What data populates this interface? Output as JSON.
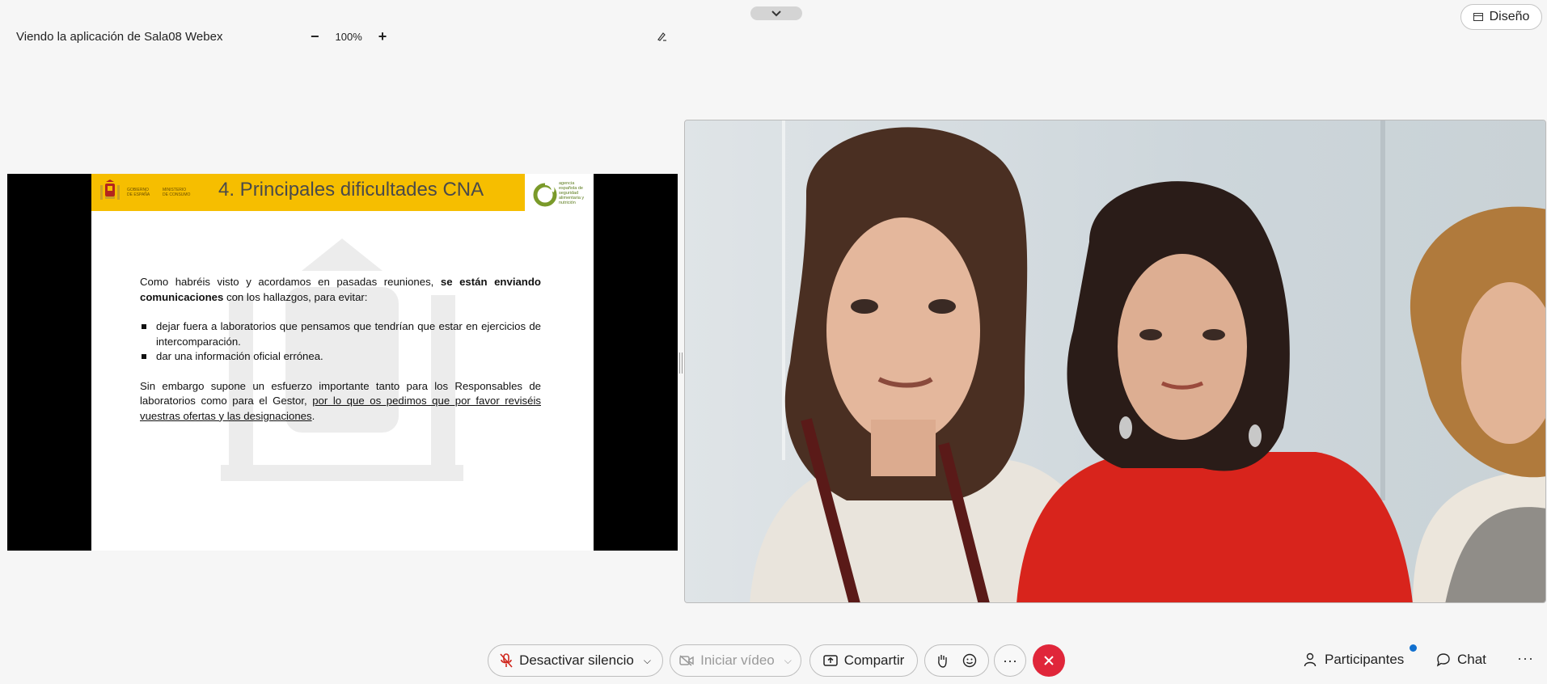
{
  "top": {
    "viewing_label": "Viendo la aplicación de Sala08 Webex",
    "zoom_minus": "−",
    "zoom_value": "100%",
    "zoom_plus": "+",
    "layout_label": "Diseño"
  },
  "slide": {
    "title": "4. Principales dificultades CNA",
    "gov_label": "GOBIERNO DE ESPAÑA",
    "ministry_label": "MINISTERIO DE CONSUMO",
    "logo_text": "agencia española de seguridad alimentaria y nutrición",
    "para1_a": "Como habréis visto y acordamos en pasadas reuniones, ",
    "para1_bold": "se están enviando comunicaciones",
    "para1_b": " con los hallazgos, para evitar:",
    "bullets": [
      "dejar fuera a laboratorios que pensamos que tendrían que estar en ejercicios de intercomparación.",
      "dar una información oficial errónea."
    ],
    "para2_a": "Sin embargo supone un esfuerzo importante tanto para los Responsables de laboratorios como para el Gestor, ",
    "para2_underline": "por lo que os pedimos que por favor reviséis vuestras ofertas y las designaciones",
    "para2_b": "."
  },
  "controls": {
    "mute_label": "Desactivar silencio",
    "video_label": "Iniciar vídeo",
    "share_label": "Compartir",
    "more_label": "···",
    "participants_label": "Participantes",
    "chat_label": "Chat",
    "more_right_label": "···"
  },
  "colors": {
    "slide_bar": "#f6be00",
    "end_call": "#e0263a",
    "notification_dot": "#1170cf"
  }
}
